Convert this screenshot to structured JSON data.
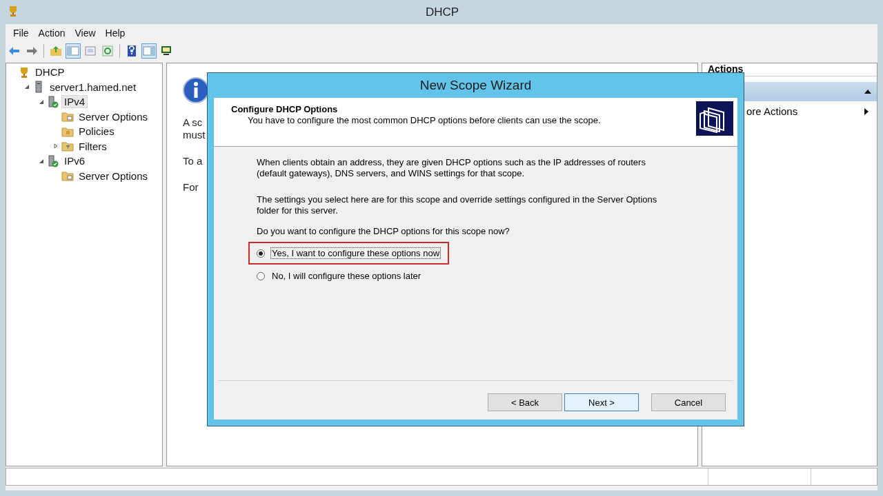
{
  "window": {
    "title": "DHCP"
  },
  "menu": [
    "File",
    "Action",
    "View",
    "Help"
  ],
  "toolbar": [
    {
      "buttons": [
        {
          "kind": "back",
          "selected": false
        },
        {
          "kind": "forward",
          "selected": false
        }
      ]
    },
    {
      "buttons": [
        {
          "kind": "up",
          "selected": false
        },
        {
          "kind": "pane",
          "selected": true
        },
        {
          "kind": "export",
          "selected": false
        },
        {
          "kind": "refresh",
          "selected": false
        }
      ]
    },
    {
      "buttons": [
        {
          "kind": "help",
          "selected": false
        },
        {
          "kind": "action-pane",
          "selected": true
        },
        {
          "kind": "monitor",
          "selected": false
        }
      ]
    }
  ],
  "tree": [
    {
      "label": "DHCP",
      "kind": "root",
      "selected": false,
      "children": [
        {
          "label": "server1.hamed.net",
          "kind": "server",
          "expanded": true,
          "selected": false,
          "children": [
            {
              "label": "IPv4",
              "kind": "ip",
              "expanded": true,
              "selected": true,
              "children": [
                {
                  "label": "Server Options",
                  "kind": "options",
                  "selected": false
                },
                {
                  "label": "Policies",
                  "kind": "policies",
                  "selected": false
                },
                {
                  "label": "Filters",
                  "kind": "filters",
                  "expanded": false,
                  "selected": false
                }
              ]
            },
            {
              "label": "IPv6",
              "kind": "ip",
              "expanded": true,
              "selected": false,
              "children": [
                {
                  "label": "Server Options",
                  "kind": "options",
                  "selected": false
                }
              ]
            }
          ]
        }
      ]
    }
  ],
  "center": {
    "lines": [
      "A sc",
      "must",
      "To a",
      "For"
    ]
  },
  "actions": {
    "title": "Actions",
    "items": [
      "ore Actions"
    ]
  },
  "dialog": {
    "title": "New Scope Wizard",
    "heading": "Configure DHCP Options",
    "subheading": "You have to configure the most common DHCP options before clients can use the scope.",
    "paragraphs": [
      "When clients obtain an address, they are given DHCP options such as the IP addresses of routers (default gateways), DNS servers, and WINS settings for that scope.",
      "The settings you select here are for this scope and override settings configured in the Server Options folder for this server."
    ],
    "question": "Do you want to configure the DHCP options for this scope now?",
    "options": [
      {
        "label": "Yes, I want to configure these options now",
        "selected": true,
        "highlighted": true
      },
      {
        "label": "No, I will configure these options later",
        "selected": false,
        "highlighted": false
      }
    ],
    "buttons": [
      {
        "label": "< Back",
        "default": false
      },
      {
        "label": "Next >",
        "default": true
      },
      {
        "label": "Cancel",
        "default": false
      }
    ]
  }
}
